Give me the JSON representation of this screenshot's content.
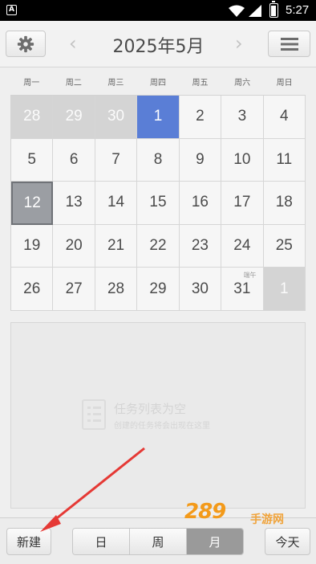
{
  "status_bar": {
    "time": "5:27",
    "left_icon": "A"
  },
  "header": {
    "title": "2025年5月",
    "prev": "‹",
    "next": "›"
  },
  "weekdays": [
    "周一",
    "周二",
    "周三",
    "周四",
    "周五",
    "周六",
    "周日"
  ],
  "calendar": [
    {
      "day": "28",
      "state": "other"
    },
    {
      "day": "29",
      "state": "other"
    },
    {
      "day": "30",
      "state": "other"
    },
    {
      "day": "1",
      "state": "today"
    },
    {
      "day": "2",
      "state": ""
    },
    {
      "day": "3",
      "state": ""
    },
    {
      "day": "4",
      "state": ""
    },
    {
      "day": "5",
      "state": ""
    },
    {
      "day": "6",
      "state": ""
    },
    {
      "day": "7",
      "state": ""
    },
    {
      "day": "8",
      "state": ""
    },
    {
      "day": "9",
      "state": ""
    },
    {
      "day": "10",
      "state": ""
    },
    {
      "day": "11",
      "state": ""
    },
    {
      "day": "12",
      "state": "selected"
    },
    {
      "day": "13",
      "state": ""
    },
    {
      "day": "14",
      "state": ""
    },
    {
      "day": "15",
      "state": ""
    },
    {
      "day": "16",
      "state": ""
    },
    {
      "day": "17",
      "state": ""
    },
    {
      "day": "18",
      "state": ""
    },
    {
      "day": "19",
      "state": ""
    },
    {
      "day": "20",
      "state": ""
    },
    {
      "day": "21",
      "state": ""
    },
    {
      "day": "22",
      "state": ""
    },
    {
      "day": "23",
      "state": ""
    },
    {
      "day": "24",
      "state": ""
    },
    {
      "day": "25",
      "state": ""
    },
    {
      "day": "26",
      "state": ""
    },
    {
      "day": "27",
      "state": ""
    },
    {
      "day": "28",
      "state": ""
    },
    {
      "day": "29",
      "state": ""
    },
    {
      "day": "30",
      "state": ""
    },
    {
      "day": "31",
      "state": "",
      "note": "端午"
    },
    {
      "day": "1",
      "state": "other"
    }
  ],
  "tasks": {
    "empty_title": "任务列表为空",
    "empty_subtitle": "创建的任务将会出现在这里"
  },
  "bottom": {
    "new_label": "新建",
    "views": [
      "日",
      "周",
      "月"
    ],
    "active_view": "月",
    "today_label": "今天"
  },
  "watermark": {
    "main": "289",
    "sub": "手游网"
  },
  "colors": {
    "today": "#5a7ed6",
    "selected": "#9b9ea3",
    "other_month": "#d4d4d4",
    "annotation": "#e53935"
  }
}
